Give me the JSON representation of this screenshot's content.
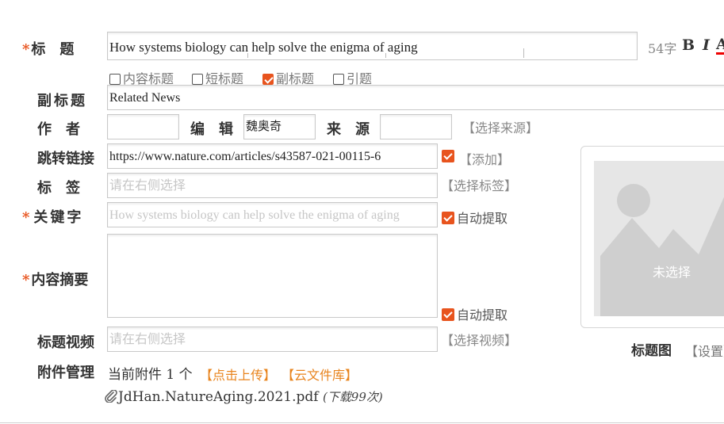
{
  "title_field": {
    "label": "标　题",
    "value": "How systems biology can help solve the enigma of aging",
    "char_count": "54字",
    "bold": "B",
    "italic": "I",
    "color": "A"
  },
  "title_options": [
    {
      "label": "内容标题",
      "checked": false
    },
    {
      "label": "短标题",
      "checked": false
    },
    {
      "label": "副标题",
      "checked": true
    },
    {
      "label": "引题",
      "checked": false
    }
  ],
  "subtitle": {
    "label": "副标题",
    "value": "Related News"
  },
  "author": {
    "label": "作　者",
    "value": ""
  },
  "editor": {
    "label": "编　辑",
    "value": "魏奥奇"
  },
  "source": {
    "label": "来　源",
    "value": "",
    "select_link": "【选择来源】"
  },
  "redirect": {
    "label": "跳转链接",
    "value": "https://www.nature.com/articles/s43587-021-00115-6",
    "add_link": "【添加】"
  },
  "tags": {
    "label": "标　签",
    "placeholder": "请在右侧选择",
    "select_link": "【选择标签】"
  },
  "keywords": {
    "label": "关键字",
    "placeholder": "How systems biology can help solve the enigma of aging",
    "auto_label": "自动提取"
  },
  "abstract": {
    "label": "内容摘要",
    "value": "",
    "auto_label": "自动提取"
  },
  "title_video": {
    "label": "标题视频",
    "placeholder": "请在右侧选择",
    "select_link": "【选择视频】"
  },
  "attachments": {
    "label": "附件管理",
    "current_text": "当前附件 1 个",
    "upload_link": "【点击上传】",
    "cloud_link": "【云文件库】",
    "file_name": "JdHan.NatureAging.2021.pdf",
    "download_count": "(下载99次)"
  },
  "title_image": {
    "label": "标题图",
    "placeholder_text": "未选择",
    "settings_link": "【设置】"
  }
}
